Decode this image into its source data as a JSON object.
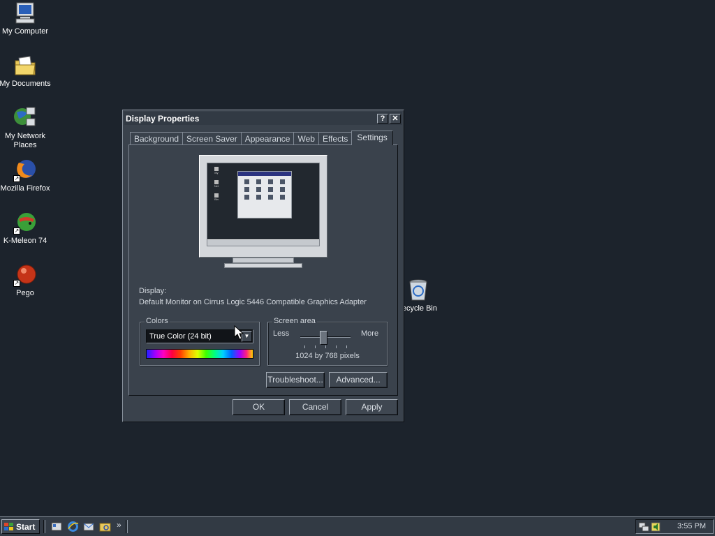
{
  "desktop": {
    "icons": [
      {
        "label": "My Computer"
      },
      {
        "label": "My Documents"
      },
      {
        "label": "My Network Places"
      },
      {
        "label": "Mozilla Firefox"
      },
      {
        "label": "K-Meleon 74"
      },
      {
        "label": "Pego"
      },
      {
        "label": "ecycle Bin"
      }
    ]
  },
  "dialog": {
    "title": "Display Properties",
    "help_button": "?",
    "close_button": "✕",
    "tabs": [
      {
        "label": "Background"
      },
      {
        "label": "Screen Saver"
      },
      {
        "label": "Appearance"
      },
      {
        "label": "Web"
      },
      {
        "label": "Effects"
      },
      {
        "label": "Settings",
        "active": true
      }
    ],
    "display_label": "Display:",
    "display_value": "Default Monitor on Cirrus Logic 5446 Compatible Graphics Adapter",
    "colors": {
      "group_label": "Colors",
      "selected": "True Color (24 bit)"
    },
    "screen_area": {
      "group_label": "Screen area",
      "less_label": "Less",
      "more_label": "More",
      "value_text": "1024 by 768 pixels",
      "slider_fraction": 0.5
    },
    "buttons": {
      "troubleshoot": "Troubleshoot...",
      "advanced": "Advanced...",
      "ok": "OK",
      "cancel": "Cancel",
      "apply": "Apply"
    }
  },
  "taskbar": {
    "start_label": "Start",
    "overflow": "»",
    "clock": "3:55 PM"
  },
  "colors": {
    "desktop_bg": "#1c232c",
    "window_face": "#3a424c",
    "text": "#d3d8de"
  }
}
